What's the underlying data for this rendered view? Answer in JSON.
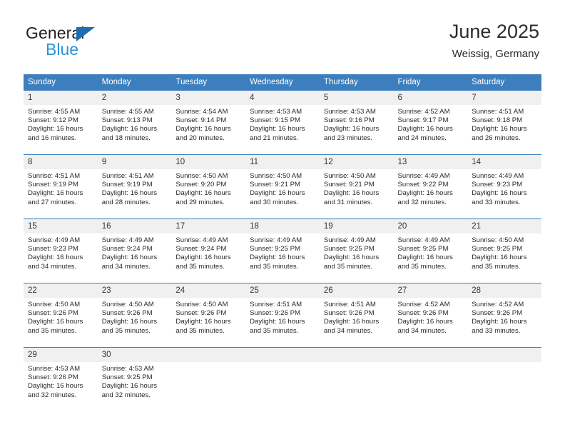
{
  "brand": {
    "name_top": "General",
    "name_bottom": "Blue",
    "triangle_color": "#1f6cb4",
    "blue_color": "#2a93d5"
  },
  "header": {
    "title": "June 2025",
    "subtitle": "Weissig, Germany"
  },
  "theme": {
    "header_bg": "#3c7ebe",
    "header_text": "#ffffff",
    "daynum_bg": "#f0f0f0",
    "cell_text": "#2a2a2a",
    "row_divider": "#3c7ebe"
  },
  "weekday_headers": [
    "Sunday",
    "Monday",
    "Tuesday",
    "Wednesday",
    "Thursday",
    "Friday",
    "Saturday"
  ],
  "weeks": [
    [
      {
        "day": "1",
        "sunrise": "Sunrise: 4:55 AM",
        "sunset": "Sunset: 9:12 PM",
        "daylight_1": "Daylight: 16 hours",
        "daylight_2": "and 16 minutes."
      },
      {
        "day": "2",
        "sunrise": "Sunrise: 4:55 AM",
        "sunset": "Sunset: 9:13 PM",
        "daylight_1": "Daylight: 16 hours",
        "daylight_2": "and 18 minutes."
      },
      {
        "day": "3",
        "sunrise": "Sunrise: 4:54 AM",
        "sunset": "Sunset: 9:14 PM",
        "daylight_1": "Daylight: 16 hours",
        "daylight_2": "and 20 minutes."
      },
      {
        "day": "4",
        "sunrise": "Sunrise: 4:53 AM",
        "sunset": "Sunset: 9:15 PM",
        "daylight_1": "Daylight: 16 hours",
        "daylight_2": "and 21 minutes."
      },
      {
        "day": "5",
        "sunrise": "Sunrise: 4:53 AM",
        "sunset": "Sunset: 9:16 PM",
        "daylight_1": "Daylight: 16 hours",
        "daylight_2": "and 23 minutes."
      },
      {
        "day": "6",
        "sunrise": "Sunrise: 4:52 AM",
        "sunset": "Sunset: 9:17 PM",
        "daylight_1": "Daylight: 16 hours",
        "daylight_2": "and 24 minutes."
      },
      {
        "day": "7",
        "sunrise": "Sunrise: 4:51 AM",
        "sunset": "Sunset: 9:18 PM",
        "daylight_1": "Daylight: 16 hours",
        "daylight_2": "and 26 minutes."
      }
    ],
    [
      {
        "day": "8",
        "sunrise": "Sunrise: 4:51 AM",
        "sunset": "Sunset: 9:19 PM",
        "daylight_1": "Daylight: 16 hours",
        "daylight_2": "and 27 minutes."
      },
      {
        "day": "9",
        "sunrise": "Sunrise: 4:51 AM",
        "sunset": "Sunset: 9:19 PM",
        "daylight_1": "Daylight: 16 hours",
        "daylight_2": "and 28 minutes."
      },
      {
        "day": "10",
        "sunrise": "Sunrise: 4:50 AM",
        "sunset": "Sunset: 9:20 PM",
        "daylight_1": "Daylight: 16 hours",
        "daylight_2": "and 29 minutes."
      },
      {
        "day": "11",
        "sunrise": "Sunrise: 4:50 AM",
        "sunset": "Sunset: 9:21 PM",
        "daylight_1": "Daylight: 16 hours",
        "daylight_2": "and 30 minutes."
      },
      {
        "day": "12",
        "sunrise": "Sunrise: 4:50 AM",
        "sunset": "Sunset: 9:21 PM",
        "daylight_1": "Daylight: 16 hours",
        "daylight_2": "and 31 minutes."
      },
      {
        "day": "13",
        "sunrise": "Sunrise: 4:49 AM",
        "sunset": "Sunset: 9:22 PM",
        "daylight_1": "Daylight: 16 hours",
        "daylight_2": "and 32 minutes."
      },
      {
        "day": "14",
        "sunrise": "Sunrise: 4:49 AM",
        "sunset": "Sunset: 9:23 PM",
        "daylight_1": "Daylight: 16 hours",
        "daylight_2": "and 33 minutes."
      }
    ],
    [
      {
        "day": "15",
        "sunrise": "Sunrise: 4:49 AM",
        "sunset": "Sunset: 9:23 PM",
        "daylight_1": "Daylight: 16 hours",
        "daylight_2": "and 34 minutes."
      },
      {
        "day": "16",
        "sunrise": "Sunrise: 4:49 AM",
        "sunset": "Sunset: 9:24 PM",
        "daylight_1": "Daylight: 16 hours",
        "daylight_2": "and 34 minutes."
      },
      {
        "day": "17",
        "sunrise": "Sunrise: 4:49 AM",
        "sunset": "Sunset: 9:24 PM",
        "daylight_1": "Daylight: 16 hours",
        "daylight_2": "and 35 minutes."
      },
      {
        "day": "18",
        "sunrise": "Sunrise: 4:49 AM",
        "sunset": "Sunset: 9:25 PM",
        "daylight_1": "Daylight: 16 hours",
        "daylight_2": "and 35 minutes."
      },
      {
        "day": "19",
        "sunrise": "Sunrise: 4:49 AM",
        "sunset": "Sunset: 9:25 PM",
        "daylight_1": "Daylight: 16 hours",
        "daylight_2": "and 35 minutes."
      },
      {
        "day": "20",
        "sunrise": "Sunrise: 4:49 AM",
        "sunset": "Sunset: 9:25 PM",
        "daylight_1": "Daylight: 16 hours",
        "daylight_2": "and 35 minutes."
      },
      {
        "day": "21",
        "sunrise": "Sunrise: 4:50 AM",
        "sunset": "Sunset: 9:25 PM",
        "daylight_1": "Daylight: 16 hours",
        "daylight_2": "and 35 minutes."
      }
    ],
    [
      {
        "day": "22",
        "sunrise": "Sunrise: 4:50 AM",
        "sunset": "Sunset: 9:26 PM",
        "daylight_1": "Daylight: 16 hours",
        "daylight_2": "and 35 minutes."
      },
      {
        "day": "23",
        "sunrise": "Sunrise: 4:50 AM",
        "sunset": "Sunset: 9:26 PM",
        "daylight_1": "Daylight: 16 hours",
        "daylight_2": "and 35 minutes."
      },
      {
        "day": "24",
        "sunrise": "Sunrise: 4:50 AM",
        "sunset": "Sunset: 9:26 PM",
        "daylight_1": "Daylight: 16 hours",
        "daylight_2": "and 35 minutes."
      },
      {
        "day": "25",
        "sunrise": "Sunrise: 4:51 AM",
        "sunset": "Sunset: 9:26 PM",
        "daylight_1": "Daylight: 16 hours",
        "daylight_2": "and 35 minutes."
      },
      {
        "day": "26",
        "sunrise": "Sunrise: 4:51 AM",
        "sunset": "Sunset: 9:26 PM",
        "daylight_1": "Daylight: 16 hours",
        "daylight_2": "and 34 minutes."
      },
      {
        "day": "27",
        "sunrise": "Sunrise: 4:52 AM",
        "sunset": "Sunset: 9:26 PM",
        "daylight_1": "Daylight: 16 hours",
        "daylight_2": "and 34 minutes."
      },
      {
        "day": "28",
        "sunrise": "Sunrise: 4:52 AM",
        "sunset": "Sunset: 9:26 PM",
        "daylight_1": "Daylight: 16 hours",
        "daylight_2": "and 33 minutes."
      }
    ],
    [
      {
        "day": "29",
        "sunrise": "Sunrise: 4:53 AM",
        "sunset": "Sunset: 9:26 PM",
        "daylight_1": "Daylight: 16 hours",
        "daylight_2": "and 32 minutes."
      },
      {
        "day": "30",
        "sunrise": "Sunrise: 4:53 AM",
        "sunset": "Sunset: 9:25 PM",
        "daylight_1": "Daylight: 16 hours",
        "daylight_2": "and 32 minutes."
      },
      {
        "day": "",
        "sunrise": "",
        "sunset": "",
        "daylight_1": "",
        "daylight_2": ""
      },
      {
        "day": "",
        "sunrise": "",
        "sunset": "",
        "daylight_1": "",
        "daylight_2": ""
      },
      {
        "day": "",
        "sunrise": "",
        "sunset": "",
        "daylight_1": "",
        "daylight_2": ""
      },
      {
        "day": "",
        "sunrise": "",
        "sunset": "",
        "daylight_1": "",
        "daylight_2": ""
      },
      {
        "day": "",
        "sunrise": "",
        "sunset": "",
        "daylight_1": "",
        "daylight_2": ""
      }
    ]
  ]
}
